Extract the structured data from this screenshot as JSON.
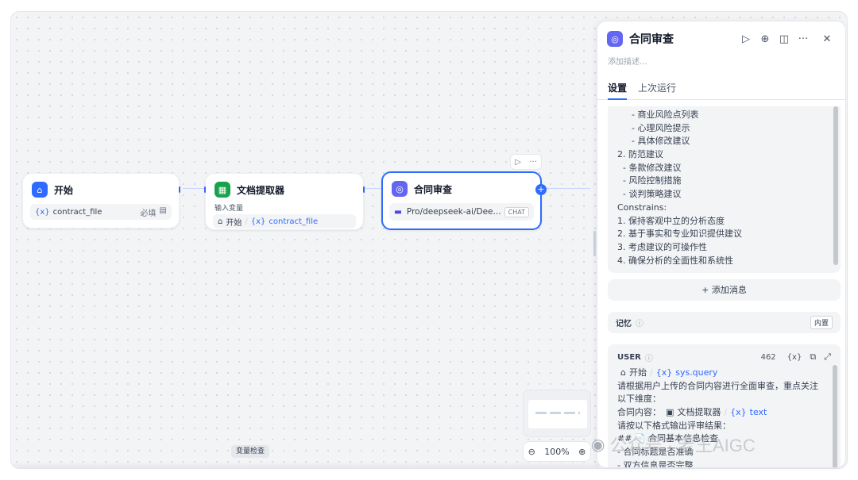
{
  "canvas": {
    "var_check_label": "变量检查",
    "zoom": "100%"
  },
  "nodes": {
    "start": {
      "title": "开始",
      "var_icon": "{x}",
      "var_name": "contract_file",
      "required": "必填"
    },
    "extractor": {
      "title": "文档提取器",
      "input_label": "输入变量",
      "src": "开始",
      "var_icon": "{x}",
      "var_name": "contract_file"
    },
    "review": {
      "title": "合同审查",
      "model": "Pro/deepseek-ai/Dee...",
      "model_tag": "CHAT"
    }
  },
  "panel": {
    "title": "合同审查",
    "desc_placeholder": "添加描述...",
    "tabs": [
      "设置",
      "上次运行"
    ],
    "prompt_lines": [
      "- 商业风险点列表",
      "- 心理风险提示",
      "- 具体修改建议",
      "2. 防范建议",
      "- 条款修改建议",
      "- 风险控制措施",
      "- 谈判策略建议",
      "Constrains:",
      "1. 保持客观中立的分析态度",
      "2. 基于事实和专业知识提供建议",
      "3. 考虑建议的可操作性",
      "4. 确保分析的全面性和系统性"
    ],
    "add_message": "+ 添加消息",
    "memory": {
      "label": "记忆",
      "badge": "内置"
    },
    "user": {
      "label": "USER",
      "count": "462",
      "var_icon": "{x}",
      "l1_src": "开始",
      "l1_var": "sys.query",
      "l2": "请根据用户上传的合同内容进行全面审查，重点关注",
      "l3": "以下维度：",
      "l4_pre": "合同内容：",
      "l4_src": "文档提取器",
      "l4_var": "text",
      "l5": "请按以下格式输出评审结果：",
      "l6": "## 📄 合同基本信息检查",
      "l7": "- 合同标题是否准确",
      "l8": "- 双方信息是否完整"
    }
  },
  "watermark": "公众号 · 老王AIGC",
  "colors": {
    "accent": "#2f6bff",
    "start_icon": "#2f6bff",
    "extractor_icon": "#16a34a",
    "review_icon": "#6366f1"
  }
}
